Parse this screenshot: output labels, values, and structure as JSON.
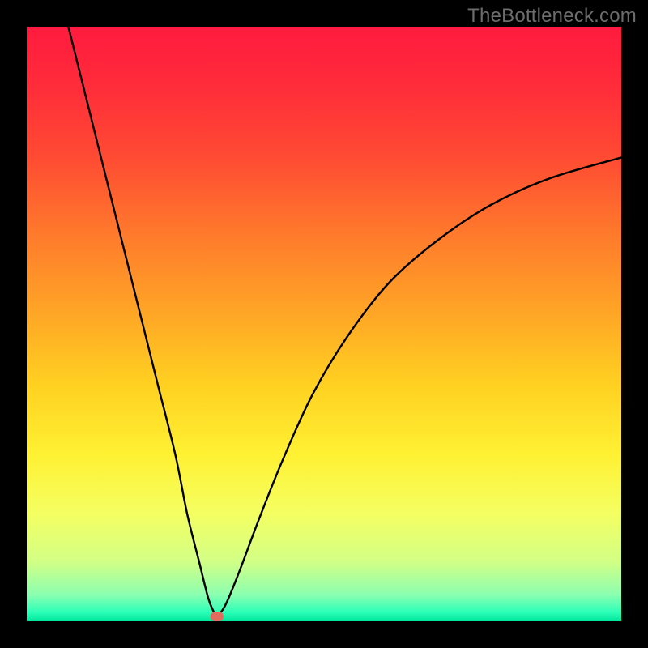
{
  "watermark": "TheBottleneck.com",
  "chart_data": {
    "type": "line",
    "title": "",
    "xlabel": "",
    "ylabel": "",
    "xlim": [
      0,
      100
    ],
    "ylim": [
      0,
      100
    ],
    "series": [
      {
        "name": "bottleneck-curve",
        "x": [
          7,
          10,
          13,
          16,
          19,
          22,
          25,
          27,
          29,
          30.5,
          31.5,
          32,
          33,
          34,
          36,
          39,
          43,
          48,
          54,
          61,
          69,
          78,
          88,
          100
        ],
        "y": [
          100,
          88,
          76,
          64,
          52,
          40,
          28,
          18,
          10,
          4,
          1.5,
          1,
          2,
          4,
          9,
          17,
          27,
          38,
          48,
          57,
          64,
          70,
          74.5,
          78
        ]
      }
    ],
    "marker": {
      "x": 32,
      "y": 0.8,
      "color": "#e46a5e"
    },
    "gradient_stops": [
      {
        "offset": 0.0,
        "color": "#ff1b3f"
      },
      {
        "offset": 0.1,
        "color": "#ff2c3a"
      },
      {
        "offset": 0.22,
        "color": "#ff4b33"
      },
      {
        "offset": 0.35,
        "color": "#ff7a2c"
      },
      {
        "offset": 0.48,
        "color": "#ffa526"
      },
      {
        "offset": 0.6,
        "color": "#ffd021"
      },
      {
        "offset": 0.72,
        "color": "#fff133"
      },
      {
        "offset": 0.82,
        "color": "#f4ff62"
      },
      {
        "offset": 0.9,
        "color": "#d2ff86"
      },
      {
        "offset": 0.955,
        "color": "#8cffb0"
      },
      {
        "offset": 0.985,
        "color": "#2bffb8"
      },
      {
        "offset": 1.0,
        "color": "#00e49a"
      }
    ]
  }
}
